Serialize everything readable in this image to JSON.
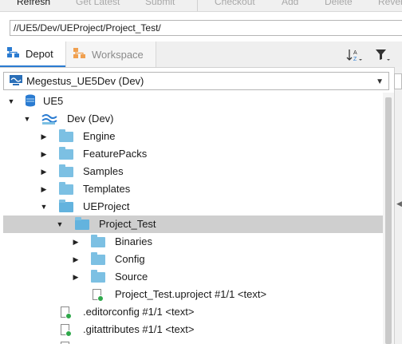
{
  "toolbar": {
    "refresh": "Refresh",
    "get_latest": "Get Latest",
    "submit": "Submit",
    "checkout": "Checkout",
    "add": "Add",
    "delete": "Delete",
    "revert": "Revert"
  },
  "path": {
    "value": "//UE5/Dev/UEProject/Project_Test/"
  },
  "tabs": {
    "depot": "Depot",
    "workspace": "Workspace"
  },
  "stream": {
    "selected": "Megestus_UE5Dev (Dev)"
  },
  "tree": {
    "ue5": "UE5",
    "dev": "Dev (Dev)",
    "engine": "Engine",
    "featurepacks": "FeaturePacks",
    "samples": "Samples",
    "templates": "Templates",
    "ueproject": "UEProject",
    "project_test": "Project_Test",
    "binaries": "Binaries",
    "config": "Config",
    "source": "Source",
    "uproject": "Project_Test.uproject #1/1 <text>",
    "editorconfig": ".editorconfig #1/1 <text>",
    "gitattributes": ".gitattributes #1/1 <text>"
  },
  "colors": {
    "folder": "#7cc0e3",
    "selection": "#cfcfcf",
    "accent": "#2a7bd1",
    "status_green": "#2fa84a"
  }
}
